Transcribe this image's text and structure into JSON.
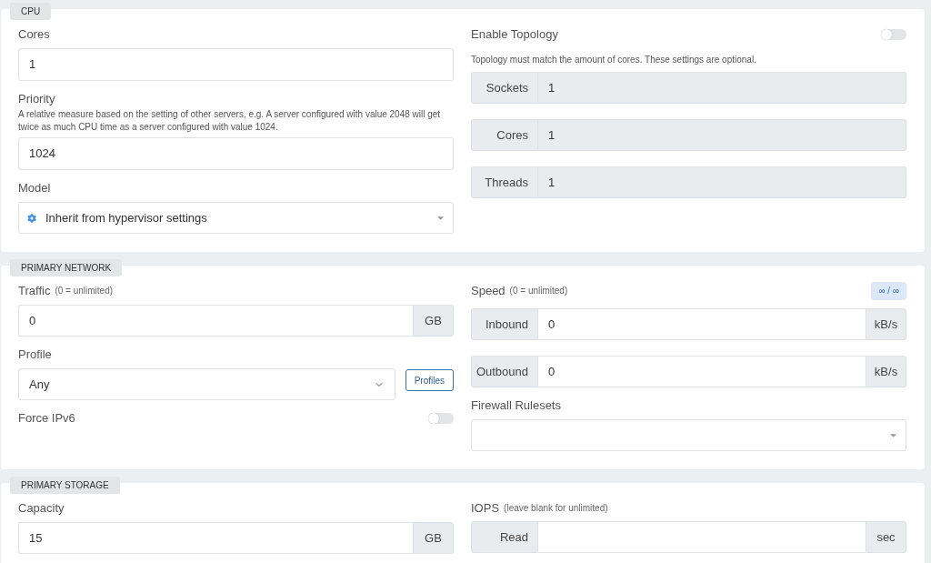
{
  "sections": [
    {
      "title": "CPU",
      "left": [
        {
          "kind": "input",
          "label": "Cores",
          "value": "1"
        },
        {
          "kind": "input",
          "label": "Priority",
          "help": "A relative measure based on the setting of other servers, e.g. A server configured with value 2048 will get twice as much CPU time as a server configured with value 1024.",
          "value": "1024"
        },
        {
          "kind": "picker",
          "label": "Model",
          "value": "Inherit from hypervisor settings"
        }
      ],
      "right": [
        {
          "kind": "toggle",
          "label": "Enable Topology",
          "on": false
        },
        {
          "kind": "help",
          "text": "Topology must match the amount of cores. These settings are optional."
        },
        {
          "kind": "group",
          "prepend": "Sockets",
          "value": "1",
          "disabled": true
        },
        {
          "kind": "group",
          "prepend": "Cores",
          "value": "1",
          "disabled": true
        },
        {
          "kind": "group",
          "prepend": "Threads",
          "value": "1",
          "disabled": true
        }
      ]
    },
    {
      "title": "PRIMARY NETWORK",
      "left": [
        {
          "kind": "input",
          "label": "Traffic",
          "note": "(0 = unlimited)",
          "value": "0",
          "append": "GB"
        },
        {
          "kind": "select",
          "label": "Profile",
          "value": "Any",
          "button": "Profiles"
        },
        {
          "kind": "toggle",
          "label": "Force IPv6",
          "on": false
        }
      ],
      "right": [
        {
          "kind": "heading",
          "label": "Speed",
          "note": "(0 = unlimited)",
          "badge": "∞ / ∞"
        },
        {
          "kind": "group",
          "prepend": "Inbound",
          "value": "0",
          "append": "kB/s",
          "disabled": false
        },
        {
          "kind": "group",
          "prepend": "Outbound",
          "value": "0",
          "append": "kB/s",
          "disabled": false
        },
        {
          "kind": "picker",
          "label": "Firewall Rulesets"
        }
      ]
    },
    {
      "title": "PRIMARY STORAGE",
      "left": [
        {
          "kind": "input",
          "label": "Capacity",
          "value": "15",
          "append": "GB"
        }
      ],
      "right": [
        {
          "kind": "heading",
          "label": "IOPS",
          "note": "(leave blank for unlimited)"
        },
        {
          "kind": "group",
          "prepend": "Read",
          "append": "sec",
          "disabled": false
        }
      ]
    }
  ]
}
